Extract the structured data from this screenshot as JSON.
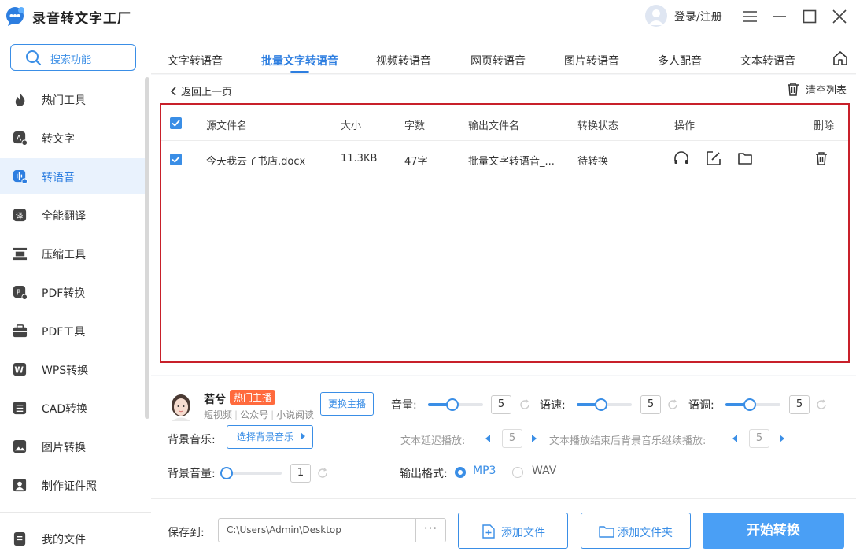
{
  "app": {
    "title": "录音转文字工厂",
    "login": "登录/注册"
  },
  "sidebar": {
    "search": "搜索功能",
    "items": [
      {
        "label": "热门工具",
        "icon": "flame-icon"
      },
      {
        "label": "转文字",
        "icon": "text-convert-icon"
      },
      {
        "label": "转语音",
        "icon": "voice-convert-icon",
        "active": true
      },
      {
        "label": "全能翻译",
        "icon": "translate-icon"
      },
      {
        "label": "压缩工具",
        "icon": "compress-icon"
      },
      {
        "label": "PDF转换",
        "icon": "pdf-convert-icon"
      },
      {
        "label": "PDF工具",
        "icon": "toolbox-icon"
      },
      {
        "label": "WPS转换",
        "icon": "wps-icon"
      },
      {
        "label": "CAD转换",
        "icon": "cad-icon"
      },
      {
        "label": "图片转换",
        "icon": "image-icon"
      },
      {
        "label": "制作证件照",
        "icon": "id-photo-icon"
      }
    ],
    "my_files": "我的文件"
  },
  "tabs": [
    {
      "label": "文字转语音"
    },
    {
      "label": "批量文字转语音",
      "active": true
    },
    {
      "label": "视频转语音"
    },
    {
      "label": "网页转语音"
    },
    {
      "label": "图片转语音"
    },
    {
      "label": "多人配音"
    },
    {
      "label": "文本转语音"
    }
  ],
  "toolbar": {
    "back": "返回上一页",
    "clear": "清空列表"
  },
  "table": {
    "headers": {
      "source": "源文件名",
      "size": "大小",
      "words": "字数",
      "output": "输出文件名",
      "status": "转换状态",
      "ops": "操作",
      "delete": "删除"
    },
    "rows": [
      {
        "source": "今天我去了书店.docx",
        "size": "11.3KB",
        "words": "47字",
        "output": "批量文字转语音_...",
        "status": "待转换",
        "checked": true
      }
    ]
  },
  "anchor": {
    "name": "若兮",
    "badge": "热门主播",
    "tags": [
      "短视频",
      "公众号",
      "小说阅读"
    ],
    "change": "更换主播"
  },
  "settings": {
    "volume": {
      "label": "音量:",
      "value": "5"
    },
    "speed": {
      "label": "语速:",
      "value": "5"
    },
    "pitch": {
      "label": "语调:",
      "value": "5"
    },
    "bgm_label": "背景音乐:",
    "bgm_button": "选择背景音乐",
    "delay_label": "文本延迟播放:",
    "delay_value": "5",
    "continue_label": "文本播放结束后背景音乐继续播放:",
    "continue_value": "5",
    "bg_volume_label": "背景音量:",
    "bg_volume_value": "1",
    "format_label": "输出格式:",
    "format_mp3": "MP3",
    "format_wav": "WAV"
  },
  "bottom": {
    "save_label": "保存到:",
    "save_path": "C:\\Users\\Admin\\Desktop",
    "more": "···",
    "add_file": "添加文件",
    "add_folder": "添加文件夹",
    "start": "开始转换"
  }
}
